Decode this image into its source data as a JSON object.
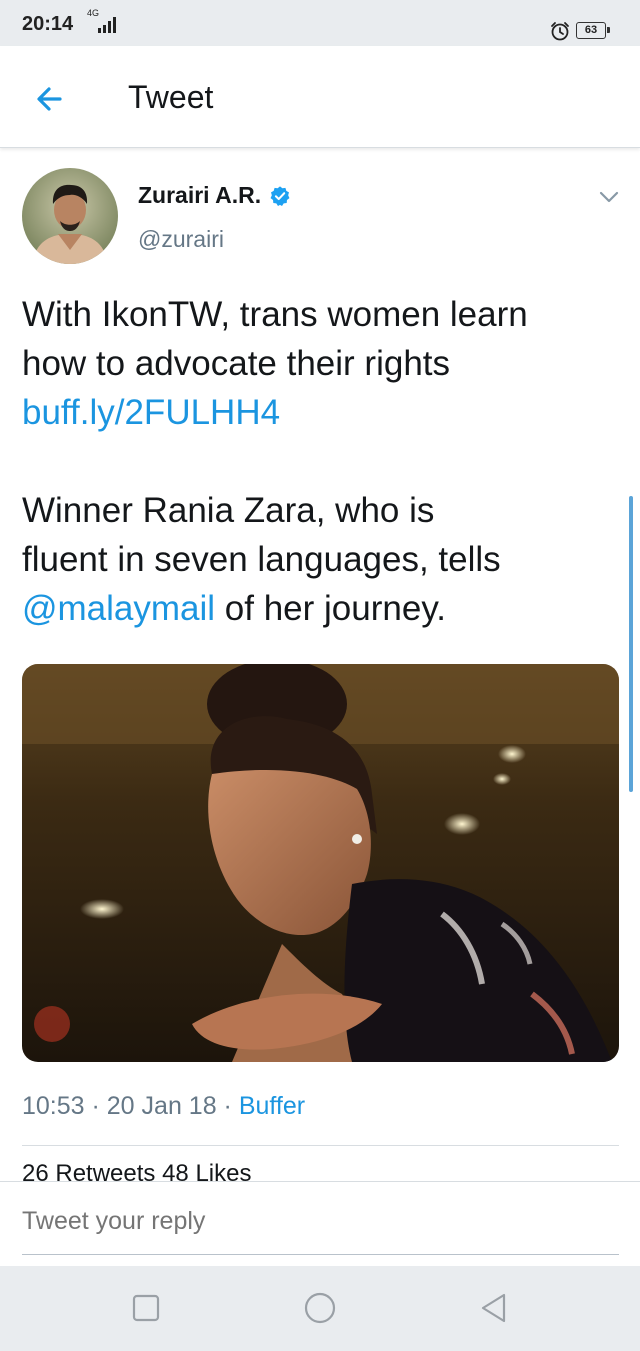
{
  "status_bar": {
    "time": "20:14",
    "network": "4G",
    "battery": "63",
    "icons": [
      "signal-icon",
      "alarm-icon",
      "battery-icon"
    ]
  },
  "header": {
    "title": "Tweet",
    "back_icon": "arrow-left-icon"
  },
  "tweet": {
    "author_name": "Zurairi A.R.",
    "handle": "@zurairi",
    "verified": true,
    "paragraph1_line1": "With IkonTW, trans women learn",
    "paragraph1_line2": "how to advocate their rights",
    "link": "buff.ly/2FULHH4",
    "paragraph2_line1": "Winner Rania Zara, who is",
    "paragraph2_line2": "fluent in seven languages, tells",
    "mention": "@malaymail",
    "paragraph2_tail": " of her journey.",
    "time": "10:53",
    "date": "20 Jan 18",
    "separator": " · ",
    "source": "Buffer",
    "stats_text": "26 Retweets    48 Likes"
  },
  "reply": {
    "placeholder": "Tweet your reply"
  },
  "colors": {
    "link": "#1b95e0",
    "text": "#14171a",
    "secondary": "#657786",
    "system_bar": "#e9ecef"
  }
}
